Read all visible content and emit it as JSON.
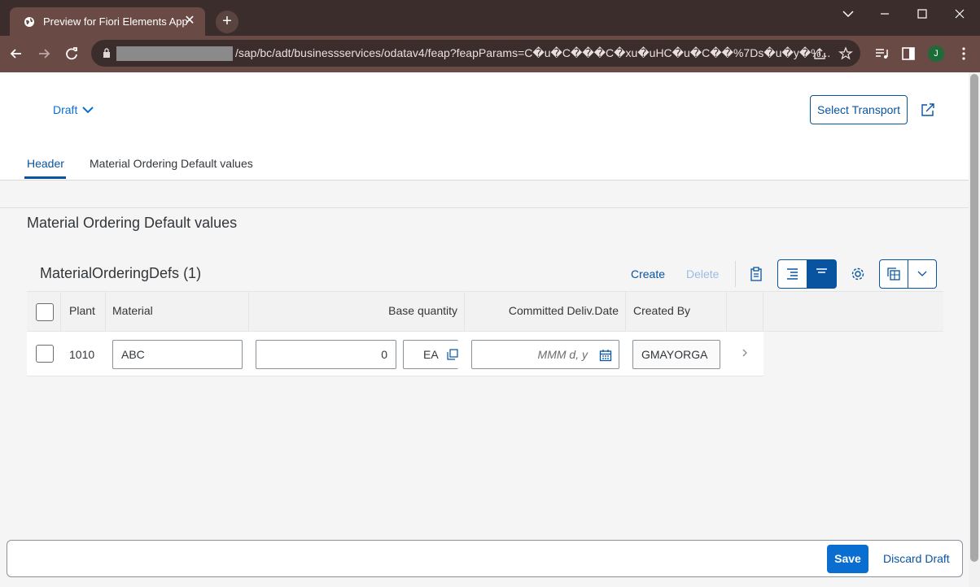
{
  "browser": {
    "tab_title": "Preview for Fiori Elements App",
    "url_path": "/sap/bc/adt/businessservices/odatav4/feap?feapParams=C�u�C���C�xu�uHC�u�C��%7Ds�u�y�%...",
    "profile_initial": "J",
    "icons": [
      "globe-icon",
      "close-icon",
      "new-tab-icon",
      "back-icon",
      "forward-icon",
      "reload-icon",
      "lock-icon",
      "share-icon",
      "star-icon",
      "media-icon",
      "side-panel-icon",
      "more-icon"
    ]
  },
  "header": {
    "draft_label": "Draft",
    "select_transport_label": "Select Transport",
    "tabs": [
      {
        "label": "Header",
        "active": true
      },
      {
        "label": "Material Ordering Default values",
        "active": false
      }
    ]
  },
  "section": {
    "title": "Material Ordering Default values"
  },
  "table": {
    "title": "MaterialOrderingDefs (1)",
    "create_label": "Create",
    "delete_label": "Delete",
    "columns": [
      "Plant",
      "Material",
      "Base quantity",
      "Committed Deliv.Date",
      "Created By"
    ],
    "rows": [
      {
        "plant": "1010",
        "material": "ABC",
        "base_quantity": "0",
        "unit": "EA",
        "date_placeholder": "MMM d, y",
        "created_by": "GMAYORGA"
      }
    ]
  },
  "footer": {
    "save_label": "Save",
    "discard_label": "Discard Draft"
  },
  "colors": {
    "accent": "#0854a0",
    "primary_button": "#0a6ed1",
    "browser_frame": "#3c2d2d",
    "browser_toolbar": "#6a4a45"
  }
}
